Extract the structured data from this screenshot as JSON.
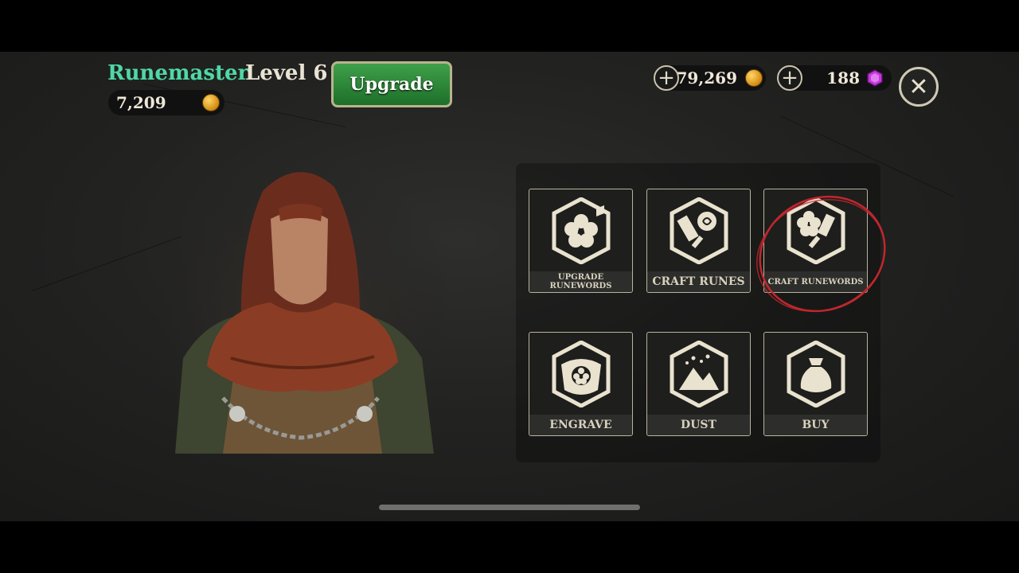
{
  "header": {
    "name": "Runemaster",
    "level": "Level 6",
    "upgrade_label": "Upgrade",
    "gold_balance": "7,209"
  },
  "currency": {
    "coins": "79,269",
    "gems": "188"
  },
  "actions": [
    {
      "label": "UPGRADE RUNEWORDS",
      "icon": "rune-flower-hammer-icon"
    },
    {
      "label": "CRAFT RUNES",
      "icon": "craft-runes-icon"
    },
    {
      "label": "CRAFT RUNEWORDS",
      "icon": "craft-runewords-icon"
    },
    {
      "label": "ENGRAVE",
      "icon": "engrave-icon"
    },
    {
      "label": "DUST",
      "icon": "dust-icon"
    },
    {
      "label": "BUY",
      "icon": "bag-icon"
    }
  ],
  "colors": {
    "name": "#4fd8a6",
    "button": "#2a8a37",
    "annotation": "#c0272d",
    "gem": "#c23ad9"
  }
}
